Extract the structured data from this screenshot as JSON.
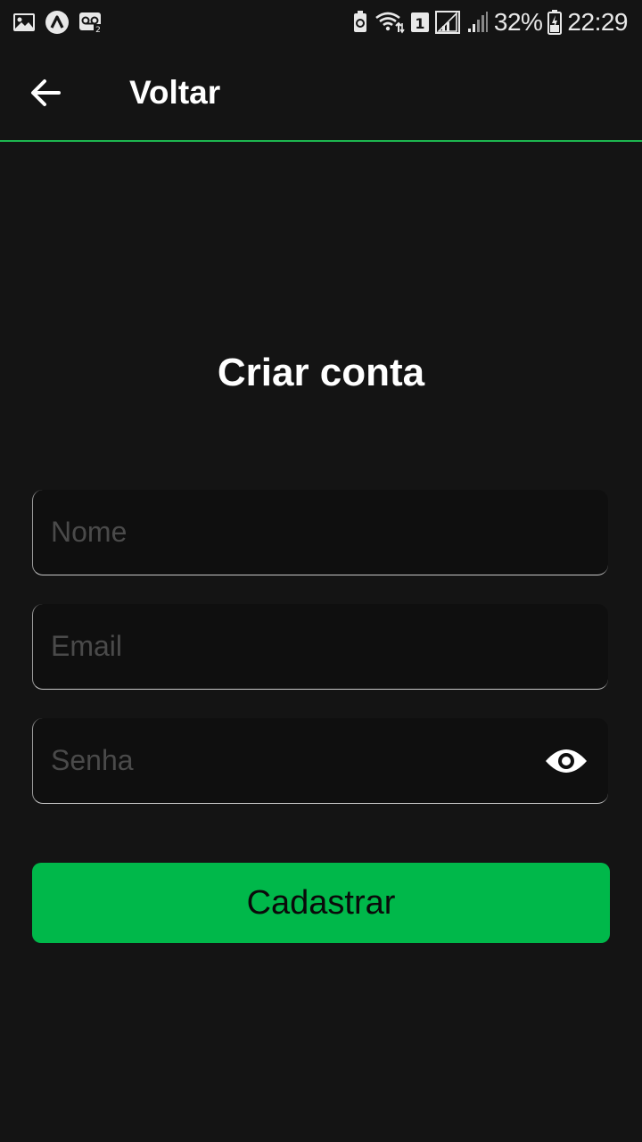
{
  "status_bar": {
    "battery_percent": "32%",
    "time": "22:29",
    "sim_badge": "1",
    "left_icons": [
      "gallery-icon",
      "app-a-icon",
      "voicemail-icon"
    ],
    "right_icons": [
      "recycle-icon",
      "wifi-icon",
      "sim-badge-icon",
      "signal-icon",
      "signal-weak-icon",
      "battery-charging-icon"
    ]
  },
  "app_bar": {
    "back_icon": "arrow-left-icon",
    "title": "Voltar",
    "divider_color": "#1db64f"
  },
  "form": {
    "title": "Criar conta",
    "name_placeholder": "Nome",
    "name_value": "",
    "email_placeholder": "Email",
    "email_value": "",
    "password_placeholder": "Senha",
    "password_value": "",
    "password_toggle_icon": "eye-icon",
    "submit_label": "Cadastrar"
  },
  "colors": {
    "background": "#141414",
    "field_background": "#0f0f0f",
    "accent": "#00b84a",
    "placeholder": "#4a4a4a"
  }
}
